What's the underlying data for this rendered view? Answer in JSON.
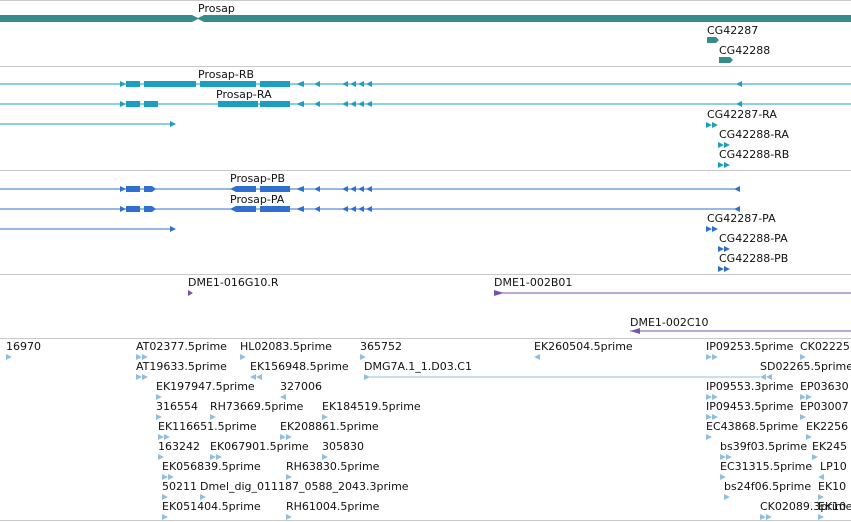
{
  "colors": {
    "gene": "#358d8a",
    "transcript": "#1a9fc0",
    "protein": "#2f6fd0",
    "clone": "#7a52ae",
    "est": "#8fbfe0",
    "separator": "#c8c8c8"
  },
  "gene_track": {
    "genes": [
      "Prosap",
      "CG42287",
      "CG42288"
    ]
  },
  "transcript_track": {
    "transcripts": [
      "Prosap-RB",
      "Prosap-RA",
      "CG42287-RA",
      "CG42288-RA",
      "CG42288-RB"
    ]
  },
  "protein_track": {
    "proteins": [
      "Prosap-PB",
      "Prosap-PA",
      "CG42287-PA",
      "CG42288-PA",
      "CG42288-PB"
    ]
  },
  "clone_track": {
    "clones": [
      "DME1-016G10.R",
      "DME1-002B01",
      "DME1-002C10"
    ]
  },
  "est_track": {
    "labels": [
      "16970",
      "AT02377.5prime",
      "HL02083.5prime",
      "365752",
      "EK260504.5prime",
      "IP09253.5prime",
      "CK02225",
      "AT19633.5prime",
      "EK156948.5prime",
      "DMG7A.1_1.D03.C1",
      "SD02265.5prime",
      "EK197947.5prime",
      "327006",
      "IP09553.3prime",
      "EP03630",
      "316554",
      "RH73669.5prime",
      "EK184519.5prime",
      "IP09453.5prime",
      "EP03007",
      "EK116651.5prime",
      "EK208861.5prime",
      "EC43868.5prime",
      "EK2256",
      "163242",
      "EK067901.5prime",
      "305830",
      "bs39f03.5prime",
      "EK245",
      "EK056839.5prime",
      "RH63830.5prime",
      "EC31315.5prime",
      "LP10",
      "50211",
      "Dmel_dig_011187_0588_2043.3prime",
      "bs24f06.5prime",
      "EK10",
      "EK051404.5prime",
      "RH61004.5prime",
      "CK02089.3prime",
      "EK10"
    ]
  }
}
